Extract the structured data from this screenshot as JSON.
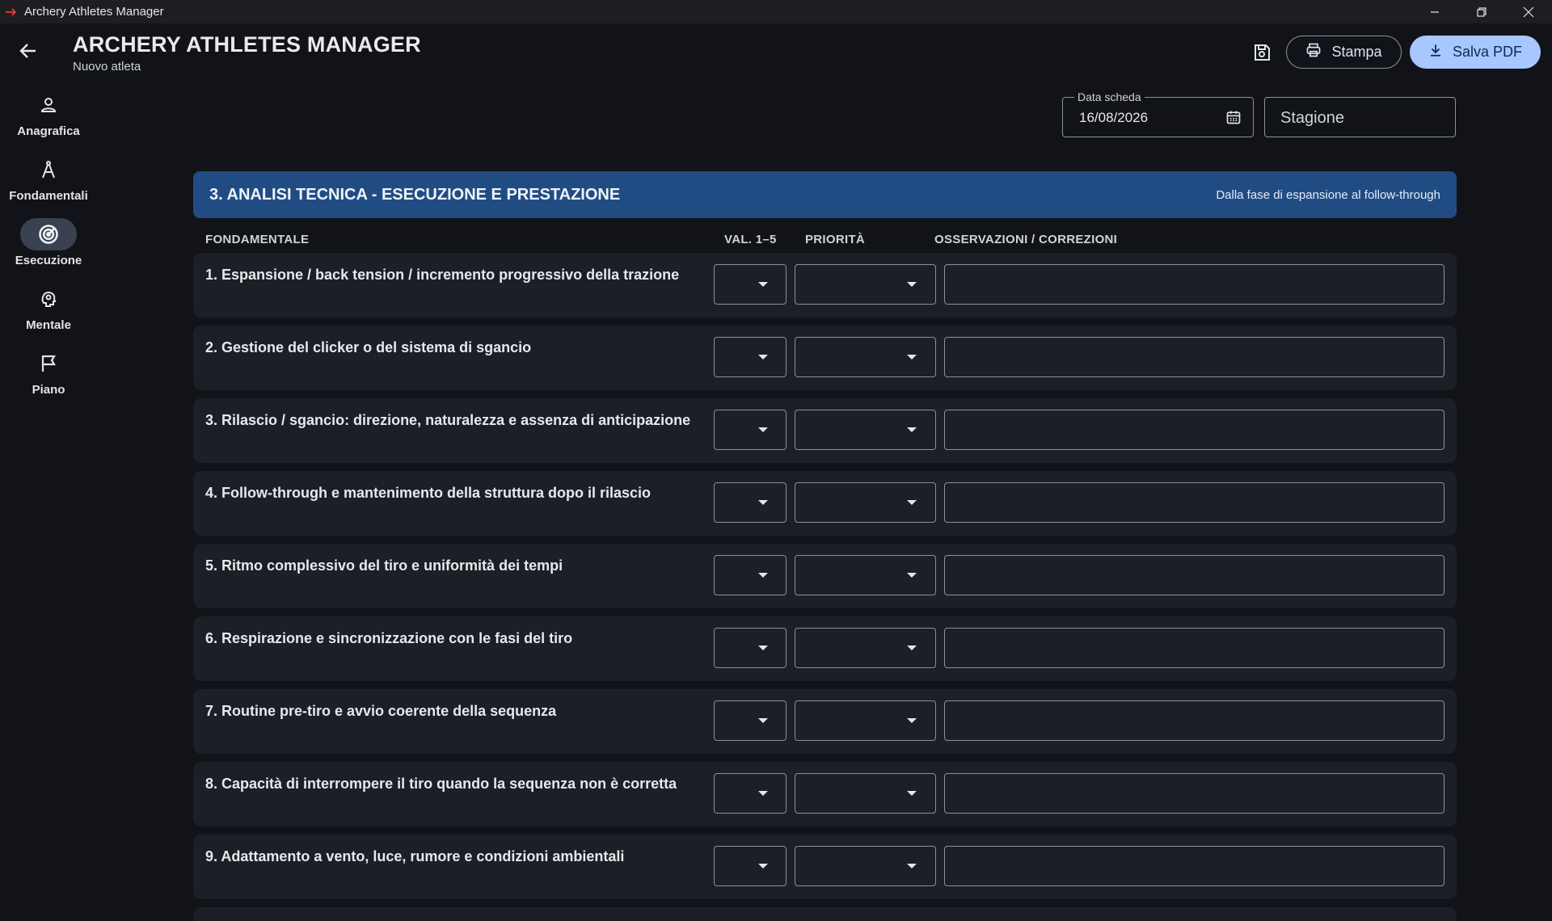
{
  "window": {
    "title": "Archery Athletes Manager"
  },
  "header": {
    "title": "ARCHERY ATHLETES MANAGER",
    "subtitle": "Nuovo atleta",
    "print_label": "Stampa",
    "save_pdf_label": "Salva PDF"
  },
  "nav": {
    "items": [
      {
        "label": "Anagrafica",
        "icon": "person-icon",
        "active": false
      },
      {
        "label": "Fondamentali",
        "icon": "compass-icon",
        "active": false
      },
      {
        "label": "Esecuzione",
        "icon": "target-icon",
        "active": true
      },
      {
        "label": "Mentale",
        "icon": "brain-icon",
        "active": false
      },
      {
        "label": "Piano",
        "icon": "flag-icon",
        "active": false
      }
    ]
  },
  "form": {
    "date_legend": "Data scheda",
    "date_value": "16/08/2026",
    "season_placeholder": "Stagione"
  },
  "section": {
    "title": "3. ANALISI TECNICA - ESECUZIONE E PRESTAZIONE",
    "subtitle": "Dalla fase di espansione al follow-through"
  },
  "columns": {
    "fundamental": "FONDAMENTALE",
    "value": "VAL. 1–5",
    "priority": "PRIORITÀ",
    "notes": "OSSERVAZIONI / CORREZIONI"
  },
  "rows": [
    {
      "label": "1. Espansione / back tension / incremento progressivo della trazione",
      "value": "",
      "priority": "",
      "notes": ""
    },
    {
      "label": "2. Gestione del clicker o del sistema di sgancio",
      "value": "",
      "priority": "",
      "notes": ""
    },
    {
      "label": "3. Rilascio / sgancio: direzione, naturalezza e assenza di anticipazione",
      "value": "",
      "priority": "",
      "notes": ""
    },
    {
      "label": "4. Follow-through e mantenimento della struttura dopo il rilascio",
      "value": "",
      "priority": "",
      "notes": ""
    },
    {
      "label": "5. Ritmo complessivo del tiro e uniformità dei tempi",
      "value": "",
      "priority": "",
      "notes": ""
    },
    {
      "label": "6. Respirazione e sincronizzazione con le fasi del tiro",
      "value": "",
      "priority": "",
      "notes": ""
    },
    {
      "label": "7. Routine pre-tiro e avvio coerente della sequenza",
      "value": "",
      "priority": "",
      "notes": ""
    },
    {
      "label": "8. Capacità di interrompere il tiro quando la sequenza non è corretta",
      "value": "",
      "priority": "",
      "notes": ""
    },
    {
      "label": "9. Adattamento a vento, luce, rumore e condizioni ambientali",
      "value": "",
      "priority": "",
      "notes": ""
    }
  ],
  "colors": {
    "background": "#111318",
    "section_header": "#214c83",
    "primary_button": "#a9c7ff",
    "row_background": "#1c1f25"
  }
}
